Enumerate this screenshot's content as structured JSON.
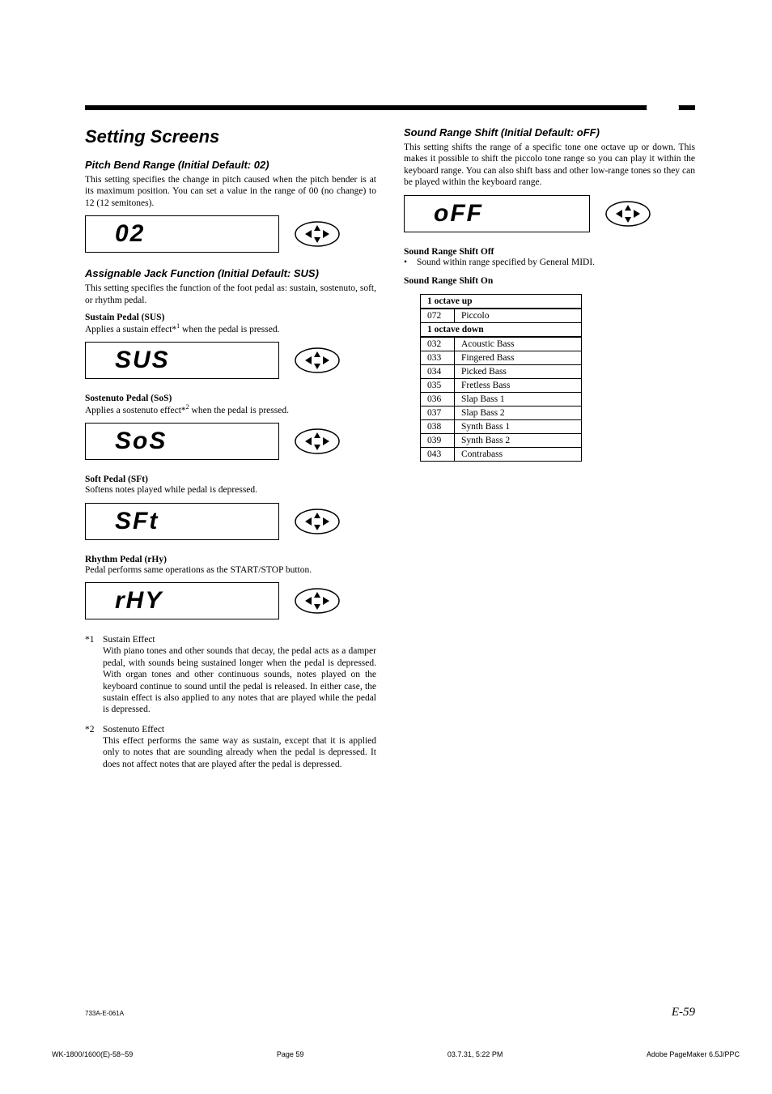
{
  "headings": {
    "main": "Setting Screens",
    "pitchBend": "Pitch Bend Range (Initial Default: 02)",
    "jack": "Assignable Jack Function (Initial Default: SUS)",
    "soundRange": "Sound Range Shift (Initial Default: oFF)"
  },
  "pitchBend": {
    "desc": "This setting specifies the change in pitch caused when the pitch bender is at its maximum position. You can set a value in the range of 00 (no change) to 12 (12 semitones).",
    "display": "02"
  },
  "jack": {
    "desc": "This setting specifies the function of the foot pedal as: sustain, sostenuto, soft, or rhythm pedal.",
    "sus": {
      "title": "Sustain Pedal (SUS)",
      "desc": "Applies a sustain effect*",
      "sup": "1",
      "desc2": " when the pedal is pressed.",
      "display": "SUS"
    },
    "sos": {
      "title": "Sostenuto Pedal (SoS)",
      "desc": "Applies a sostenuto effect*",
      "sup": "2",
      "desc2": " when the pedal is pressed.",
      "display": "SoS"
    },
    "sft": {
      "title": "Soft Pedal (SFt)",
      "desc": "Softens notes played while pedal is depressed.",
      "display": "SFt"
    },
    "rhy": {
      "title": "Rhythm Pedal (rHy)",
      "desc": "Pedal performs same operations as the START/STOP button.",
      "display": "rHY"
    }
  },
  "footnotes": {
    "f1mark": "*1",
    "f1title": "Sustain Effect",
    "f1body": "With piano tones and other sounds that decay, the pedal acts as a damper pedal, with sounds being sustained longer when the pedal is depressed. With organ tones and other continuous sounds, notes played on the keyboard continue to sound until the pedal is released. In either case, the sustain effect is also applied to any notes that are played while the pedal is depressed.",
    "f2mark": "*2",
    "f2title": "Sostenuto Effect",
    "f2body": "This effect performs the same way as sustain, except that it is applied only to notes that are sounding already when the pedal is depressed. It does not affect notes that are played after the pedal is depressed."
  },
  "soundRange": {
    "desc": "This setting shifts the range of a specific tone one octave up or down. This makes it possible to shift the piccolo tone range so you can play it within the keyboard range. You can also shift bass and other low-range tones so they can be played within the keyboard range.",
    "display": "oFF",
    "offTitle": "Sound Range Shift Off",
    "offDesc": "Sound within range specified by General MIDI.",
    "onTitle": "Sound Range Shift On",
    "upLabel": "1 octave up",
    "downLabel": "1 octave down",
    "upRows": [
      {
        "n": "072",
        "t": "Piccolo"
      }
    ],
    "downRows": [
      {
        "n": "032",
        "t": "Acoustic Bass"
      },
      {
        "n": "033",
        "t": "Fingered Bass"
      },
      {
        "n": "034",
        "t": "Picked Bass"
      },
      {
        "n": "035",
        "t": "Fretless Bass"
      },
      {
        "n": "036",
        "t": "Slap Bass 1"
      },
      {
        "n": "037",
        "t": "Slap Bass 2"
      },
      {
        "n": "038",
        "t": "Synth Bass 1"
      },
      {
        "n": "039",
        "t": "Synth Bass 2"
      },
      {
        "n": "043",
        "t": "Contrabass"
      }
    ]
  },
  "page": {
    "num": "E-59",
    "ref": "733A-E-061A",
    "footerLeft": "WK-1800/1600(E)-58~59",
    "footerPage": "Page 59",
    "footerDate": "03.7.31, 5:22 PM",
    "footerApp": "Adobe PageMaker 6.5J/PPC"
  }
}
